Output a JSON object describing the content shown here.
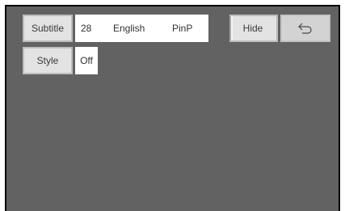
{
  "subtitle": {
    "button_label": "Subtitle",
    "size_value": "28",
    "language_value": "English",
    "mode_value": "PinP"
  },
  "style": {
    "button_label": "Style",
    "value": "Off"
  },
  "controls": {
    "hide_label": "Hide",
    "back_icon": "return-arrow-icon"
  },
  "colors": {
    "background": "#626262",
    "button": "#e3e3e3",
    "panel": "#ffffff"
  }
}
